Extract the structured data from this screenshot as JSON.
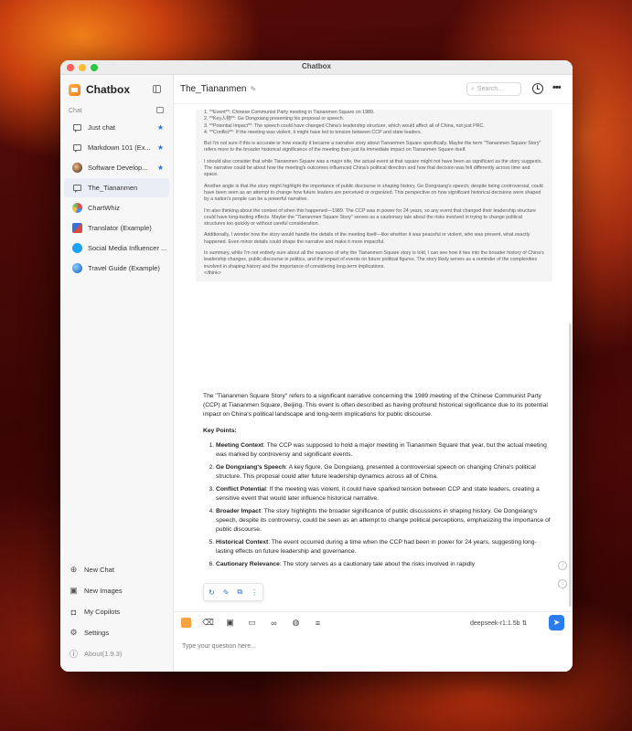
{
  "window": {
    "title": "Chatbox"
  },
  "brand": {
    "name": "Chatbox"
  },
  "sidebar": {
    "section_label": "Chat",
    "chats": [
      {
        "label": "Just chat",
        "starred": true
      },
      {
        "label": "Markdown 101 (Ex...",
        "starred": true
      },
      {
        "label": "Software Develop...",
        "starred": true
      },
      {
        "label": "The_Tiananmen",
        "starred": false
      },
      {
        "label": "ChartWhiz",
        "starred": false
      },
      {
        "label": "Translator (Example)",
        "starred": false
      },
      {
        "label": "Social Media Influencer ...",
        "starred": false
      },
      {
        "label": "Travel Guide (Example)",
        "starred": false
      }
    ],
    "bottom": [
      {
        "label": "New Chat"
      },
      {
        "label": "New Images"
      },
      {
        "label": "My Copilots"
      },
      {
        "label": "Settings"
      },
      {
        "label": "About(1.9.3)"
      }
    ]
  },
  "header": {
    "title": "The_Tiananmen",
    "search_placeholder": "Search..."
  },
  "thinking": {
    "list": [
      "1. **Event**: Chinese Communist Party meeting in Tiananmen Square on 1989.",
      "2. **Key人物**: Ge Dongxiang presenting his proposal or speech.",
      "3. **Potential Impact**: The speech could have changed China's leadership structure, which would affect all of China, not just PRC.",
      "4. **Conflict**: If the meeting was violent, it might have led to tension between CCP and state leaders."
    ],
    "paragraphs": [
      "But I'm not sure if this is accurate or how exactly it became a narrative story about Tiananmen Square specifically. Maybe the term \"Tiananmen Square Story\" refers more to the broader historical significance of the meeting than just its immediate impact on Tiananmen Square itself.",
      "I should also consider that while Tiananmen Square was a major site, the actual event at that square might not have been as significant as the story suggests. The narrative could be about how the meeting's outcomes influenced China's political direction and how that decision was felt differently across time and space.",
      "Another angle is that the story might highlight the importance of public discourse in shaping history. Ge Dongxiang's speech, despite being controversial, could have been seen as an attempt to change how future leaders are perceived or organized. This perspective on how significant historical decisions were shaped by a nation's people can be a powerful narrative.",
      "I'm also thinking about the context of when this happened—1989. The CCP was in power for 24 years, so any event that changed their leadership structure could have long-lasting effects. Maybe the \"Tiananmen Square Story\" serves as a cautionary tale about the risks involved in trying to change political structures too quickly or without careful consideration.",
      "Additionally, I wonder how the story would handle the details of the meeting itself—like whether it was peaceful or violent, who was present, what exactly happened. Even minor details could shape the narrative and make it more impactful.",
      "In summary, while I'm not entirely sure about all the nuances of why the Tiananmen Square story is told, I can see how it ties into the broader history of China's leadership changes, public discourse in politics, and the impact of events on future political figures. The story likely serves as a reminder of the complexities involved in shaping history and the importance of considering long-term implications."
    ],
    "close_tag": "</think>"
  },
  "answer": {
    "intro": "The \"Tiananmen Square Story\" refers to a significant narrative concerning the 1989 meeting of the Chinese Communist Party (CCP) at Tiananmen Square, Beijing. This event is often described as having profound historical significance due to its potential impact on China's political landscape and long-term implications for public discourse.",
    "key_points_label": "Key Points:",
    "points": [
      {
        "title": "Meeting Context",
        "text": ": The CCP was supposed to hold a major meeting in Tiananmen Square that year, but the actual meeting was marked by controversy and significant events."
      },
      {
        "title": "Ge Dongxiang's Speech",
        "text": ": A key figure, Ge Dongxiang, presented a controversial speech on changing China's political structure. This proposal could alter future leadership dynamics across all of China."
      },
      {
        "title": "Conflict Potential",
        "text": ": If the meeting was violent, it could have sparked tension between CCP and state leaders, creating a sensitive event that would later influence historical narrative."
      },
      {
        "title": "Broader Impact",
        "text": ": The story highlights the broader significance of public discussions in shaping history. Ge Dongxiang's speech, despite its controversy, could be seen as an attempt to change political perceptions, emphasizing the importance of public discourse."
      },
      {
        "title": "Historical Context",
        "text": ": The event occurred during a time when the CCP had been in power for 24 years, suggesting long-lasting effects on future leadership and governance."
      },
      {
        "title": "Cautionary Relevance",
        "text": ": The story serves as a cautionary tale about the risks involved in rapidly"
      }
    ]
  },
  "input": {
    "placeholder": "Type your question here...",
    "model": "deepseek-r1:1.5b"
  }
}
